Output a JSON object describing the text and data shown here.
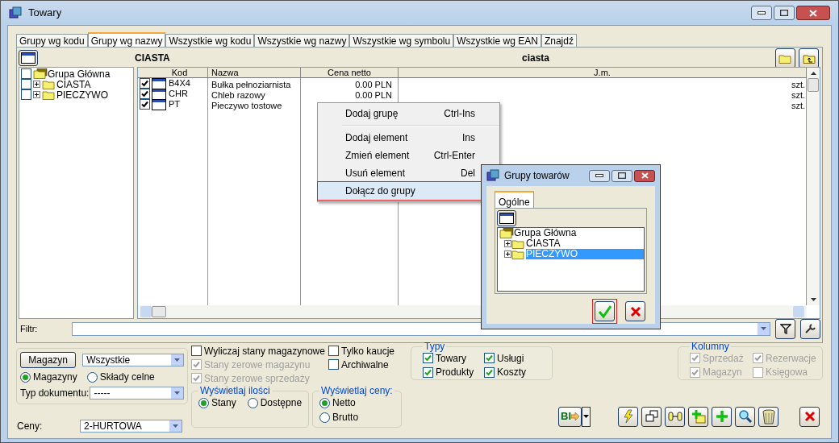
{
  "window": {
    "title": "Towary"
  },
  "tabs": [
    {
      "label": "Grupy wg kodu",
      "selected": false
    },
    {
      "label": "Grupy wg nazwy",
      "selected": true
    },
    {
      "label": "Wszystkie wg kodu",
      "selected": false
    },
    {
      "label": "Wszystkie wg nazwy",
      "selected": false
    },
    {
      "label": "Wszystkie wg symbolu",
      "selected": false
    },
    {
      "label": "Wszystkie wg EAN",
      "selected": false
    },
    {
      "label": "Znajdź",
      "selected": false
    }
  ],
  "group_bar": {
    "code": "CIASTA",
    "name": "ciasta"
  },
  "tree": [
    {
      "label": "Grupa Główna",
      "checked": false,
      "children": [
        {
          "label": "CIASTA",
          "checked": false
        },
        {
          "label": "PIECZYWO",
          "checked": false
        }
      ]
    }
  ],
  "table": {
    "columns": [
      "Kod",
      "Nazwa",
      "Cena netto",
      "J.m."
    ],
    "rows": [
      {
        "checked": true,
        "kod": "B4X4",
        "nazwa": "Bułka pełnoziarnista",
        "cena": "0.00 PLN",
        "jm": "szt."
      },
      {
        "checked": true,
        "kod": "CHR",
        "nazwa": "Chleb razowy",
        "cena": "0.00 PLN",
        "jm": "szt."
      },
      {
        "checked": true,
        "kod": "PT",
        "nazwa": "Pieczywo tostowe",
        "jm": "szt."
      }
    ]
  },
  "filter": {
    "label": "Filtr:"
  },
  "context_menu": {
    "items": [
      {
        "kind": "item",
        "label": "Dodaj grupę",
        "shortcut": "Ctrl-Ins",
        "selected": false
      },
      {
        "kind": "separator"
      },
      {
        "kind": "item",
        "label": "Dodaj element",
        "shortcut": "Ins",
        "selected": false
      },
      {
        "kind": "item",
        "label": "Zmień element",
        "shortcut": "Ctrl-Enter",
        "selected": false
      },
      {
        "kind": "item",
        "label": "Usuń element",
        "shortcut": "Del",
        "selected": false
      },
      {
        "kind": "item",
        "label": "Dołącz do grupy",
        "selected": true
      }
    ]
  },
  "dialog": {
    "title": "Grupy towarów",
    "tabs": [
      {
        "label": "Ogólne",
        "selected": true
      }
    ],
    "tree": [
      {
        "label": "Grupa Główna",
        "selected": false,
        "children": [
          {
            "label": "CIASTA",
            "selected": false
          },
          {
            "label": "PIECZYWO",
            "selected": true
          }
        ]
      }
    ]
  },
  "warehouse": {
    "button": "Magazyn",
    "select": "Wszystkie",
    "radios": [
      {
        "label": "Magazyny",
        "selected": true
      },
      {
        "label": "Składy celne",
        "selected": false
      }
    ],
    "doc_type_label": "Typ dokumentu:",
    "doc_type": "-----",
    "prices_label": "Ceny:",
    "prices": "2-HURTOWA"
  },
  "stock_options": [
    {
      "label": "Wyliczaj stany magazynowe",
      "checked": false,
      "disabled": false
    },
    {
      "label": "Stany zerowe magazynu",
      "checked": true,
      "disabled": true
    },
    {
      "label": "Stany zerowe sprzedaży",
      "checked": true,
      "disabled": true
    }
  ],
  "extra_options": [
    {
      "label": "Tylko kaucje",
      "checked": false,
      "disabled": false
    },
    {
      "label": "Archiwalne",
      "checked": false,
      "disabled": false
    }
  ],
  "quantity_group": {
    "title": "Wyświetlaj ilości",
    "radios": [
      {
        "label": "Stany",
        "selected": true
      },
      {
        "label": "Dostępne",
        "selected": false
      }
    ]
  },
  "price_group": {
    "title": "Wyświetlaj ceny:",
    "radios": [
      {
        "label": "Netto",
        "selected": true
      },
      {
        "label": "Brutto",
        "selected": false
      }
    ]
  },
  "types_group": {
    "title": "Typy",
    "disabled": false,
    "items": [
      {
        "label": "Towary",
        "checked": true
      },
      {
        "label": "Usługi",
        "checked": true
      },
      {
        "label": "Produkty",
        "checked": true
      },
      {
        "label": "Koszty",
        "checked": true
      }
    ]
  },
  "columns_group": {
    "title": "Kolumny",
    "disabled": true,
    "items": [
      {
        "label": "Sprzedaż",
        "checked": true
      },
      {
        "label": "Rezerwacje",
        "checked": true
      },
      {
        "label": "Magazyn",
        "checked": true
      },
      {
        "label": "Księgowa",
        "checked": false
      }
    ]
  },
  "bi_button": {
    "label": "BI"
  }
}
